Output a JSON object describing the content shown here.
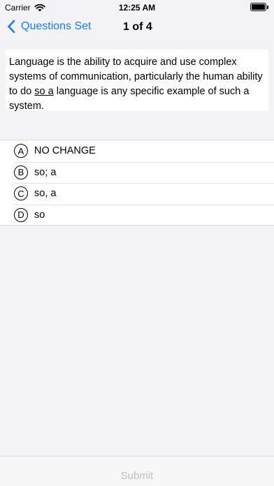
{
  "status_bar": {
    "carrier": "Carrier",
    "time": "12:25 AM",
    "wifi_icon": "wifi-icon",
    "battery_icon": "battery-icon"
  },
  "nav": {
    "back_label": "Questions Set",
    "back_icon": "chevron-left-icon",
    "title": "1 of 4",
    "accent_color": "#1a7cf5"
  },
  "question": {
    "text_before": "Language is the ability to acquire and use complex systems of communication, particularly the human ability to do ",
    "underlined": "so a",
    "text_after": " language is any specific example of such a system."
  },
  "options": [
    {
      "letter": "A",
      "text": "NO CHANGE"
    },
    {
      "letter": "B",
      "text": "so; a"
    },
    {
      "letter": "C",
      "text": "so, a"
    },
    {
      "letter": "D",
      "text": "so"
    }
  ],
  "submit": {
    "label": "Submit",
    "enabled": false
  }
}
